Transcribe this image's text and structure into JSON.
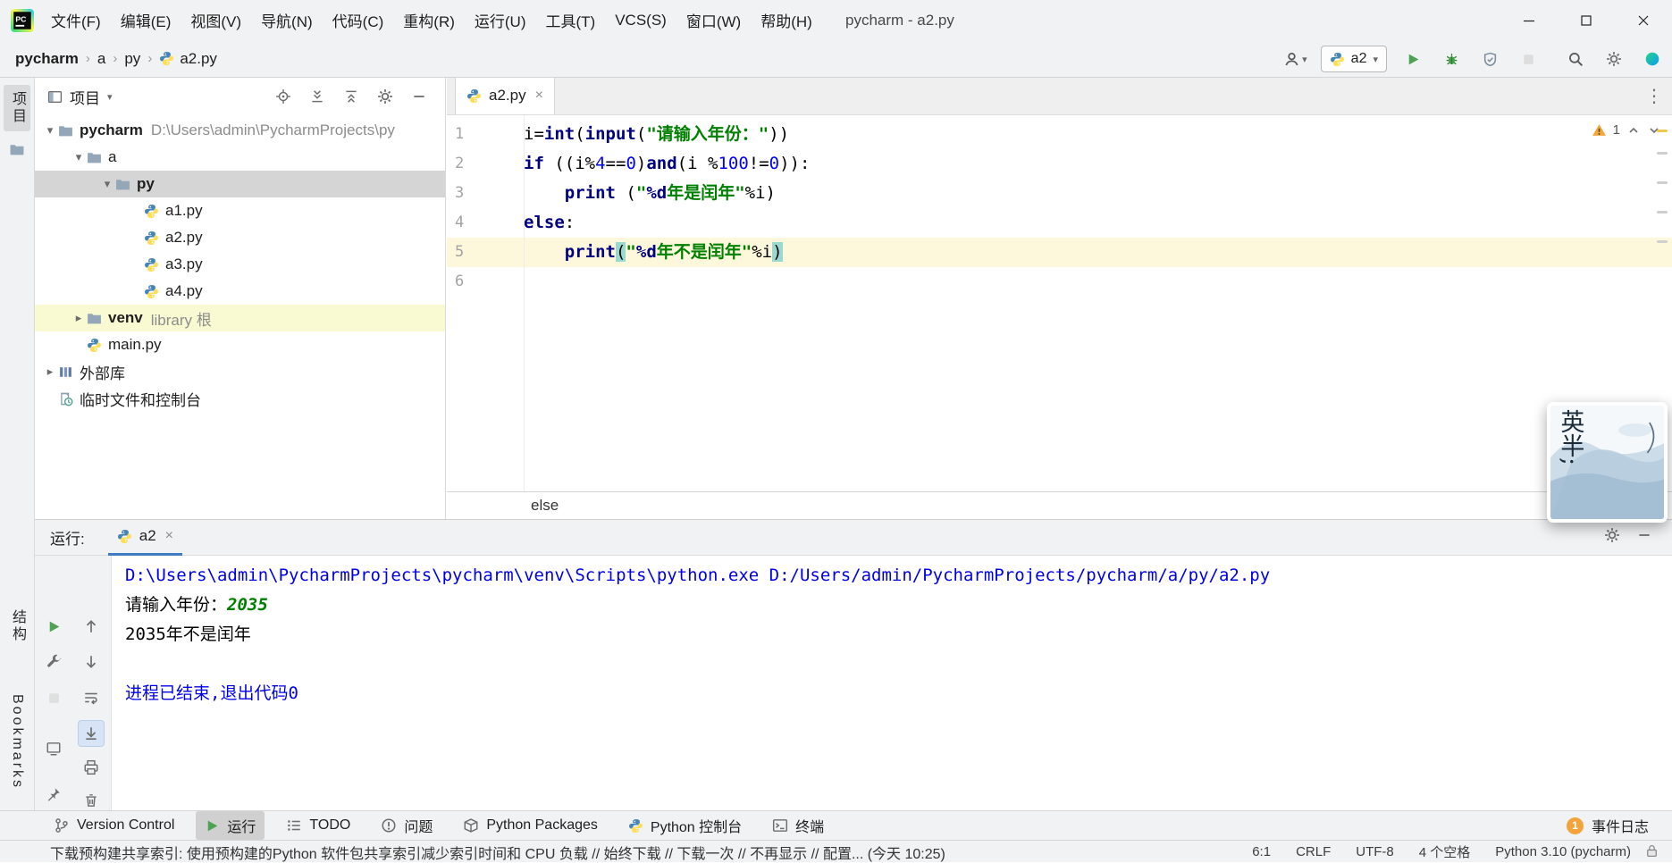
{
  "titlebar": {
    "menus": [
      "文件(F)",
      "编辑(E)",
      "视图(V)",
      "导航(N)",
      "代码(C)",
      "重构(R)",
      "运行(U)",
      "工具(T)",
      "VCS(S)",
      "窗口(W)",
      "帮助(H)"
    ],
    "title": "pycharm - a2.py"
  },
  "navbar": {
    "breadcrumbs": [
      {
        "label": "pycharm",
        "bold": true
      },
      {
        "label": "a"
      },
      {
        "label": "py"
      },
      {
        "label": "a2.py",
        "icon": "python-file"
      }
    ],
    "run_config": {
      "label": "a2"
    },
    "action_icons": [
      {
        "name": "run"
      },
      {
        "name": "debug"
      },
      {
        "name": "coverage"
      },
      {
        "name": "stop",
        "disabled": true
      }
    ],
    "tool_icons": [
      "search",
      "settings",
      "sphere"
    ]
  },
  "stripes": {
    "left_top": "项目",
    "left_middle": "结构",
    "left_bottom": "Bookmarks"
  },
  "project_panel": {
    "title": "项目",
    "header_icons": [
      "locate",
      "expand-all",
      "collapse-all",
      "settings",
      "hide"
    ],
    "tree": [
      {
        "label": "pycharm",
        "sublabel": "D:\\Users\\admin\\PycharmProjects\\py",
        "indent": 0,
        "chevron": "down",
        "icon": "folder",
        "bold": true
      },
      {
        "label": "a",
        "indent": 1,
        "chevron": "down",
        "icon": "folder"
      },
      {
        "label": "py",
        "indent": 2,
        "chevron": "down",
        "icon": "folder",
        "bold": true,
        "state": "selected"
      },
      {
        "label": "a1.py",
        "indent": 3,
        "icon": "python-file"
      },
      {
        "label": "a2.py",
        "indent": 3,
        "icon": "python-file"
      },
      {
        "label": "a3.py",
        "indent": 3,
        "icon": "python-file"
      },
      {
        "label": "a4.py",
        "indent": 3,
        "icon": "python-file"
      },
      {
        "label": "venv",
        "sublabel": "library 根",
        "indent": 1,
        "chevron": "right",
        "icon": "folder",
        "bold": true,
        "state": "library"
      },
      {
        "label": "main.py",
        "indent": 1,
        "icon": "python-file"
      },
      {
        "label": "外部库",
        "indent": 0,
        "chevron": "right",
        "icon": "libraries"
      },
      {
        "label": "临时文件和控制台",
        "indent": 0,
        "icon": "scratches"
      }
    ]
  },
  "editor": {
    "tab": {
      "label": "a2.py",
      "icon": "python-file"
    },
    "inspection": {
      "warnings": "1"
    },
    "breadcrumb": "else",
    "code": [
      {
        "num": "1",
        "tokens": [
          [
            "i=",
            "p"
          ],
          [
            "int",
            "kw"
          ],
          [
            "(",
            "p"
          ],
          [
            "input",
            "kw"
          ],
          [
            "(",
            "p"
          ],
          [
            "\"请输入年份：\"",
            "str"
          ],
          [
            "))",
            "p"
          ]
        ]
      },
      {
        "num": "2",
        "tokens": [
          [
            "if",
            "kw"
          ],
          [
            " ((i%",
            "p"
          ],
          [
            "4",
            "num"
          ],
          [
            "==",
            "p"
          ],
          [
            "0",
            "num"
          ],
          [
            ")",
            "p"
          ],
          [
            "and",
            "kw"
          ],
          [
            "(i %",
            "p"
          ],
          [
            "100",
            "num"
          ],
          [
            "!=",
            "p"
          ],
          [
            "0",
            "num"
          ],
          [
            ")):",
            "p"
          ]
        ]
      },
      {
        "num": "3",
        "tokens": [
          [
            "    ",
            "p"
          ],
          [
            "print",
            "kw"
          ],
          [
            " (",
            "p"
          ],
          [
            "\"",
            "str"
          ],
          [
            "%d",
            "fmt"
          ],
          [
            "年是闰年\"",
            "str"
          ],
          [
            "%i)",
            "p"
          ]
        ]
      },
      {
        "num": "4",
        "tokens": [
          [
            "else",
            "kw"
          ],
          [
            ":",
            "p"
          ]
        ]
      },
      {
        "num": "5",
        "current": true,
        "tokens": [
          [
            "    ",
            "p"
          ],
          [
            "print",
            "kw"
          ],
          [
            "(",
            "paren"
          ],
          [
            "\"",
            "str"
          ],
          [
            "%d",
            "fmt"
          ],
          [
            "年不是闰年\"",
            "str"
          ],
          [
            "%i",
            "p"
          ],
          [
            ")",
            "paren"
          ]
        ]
      },
      {
        "num": "6",
        "tokens": []
      }
    ]
  },
  "ime_popup": {
    "text": "英半;"
  },
  "run_panel": {
    "label": "运行:",
    "tab": {
      "label": "a2",
      "icon": "python-file"
    },
    "toolbar_col1": [
      {
        "name": "rerun"
      },
      {
        "name": "wrench"
      },
      {
        "name": "stop",
        "disabled": true
      },
      {
        "name": "console"
      },
      {
        "name": "pin"
      }
    ],
    "toolbar_col2": [
      {
        "name": "step-up"
      },
      {
        "name": "step-down"
      },
      {
        "name": "soft-wrap"
      },
      {
        "name": "scroll-end",
        "selected": true
      },
      {
        "name": "print"
      },
      {
        "name": "clear"
      }
    ],
    "header_icons": [
      "settings",
      "hide"
    ],
    "console": [
      {
        "segments": [
          [
            "D:\\Users\\admin\\PycharmProjects\\pycharm\\venv\\Scripts\\python.exe D:/Users/admin/PycharmProjects/pycharm/a/py/a2.py",
            "sys"
          ]
        ]
      },
      {
        "segments": [
          [
            "请输入年份：",
            "out"
          ],
          [
            "2035",
            "inp"
          ]
        ]
      },
      {
        "segments": [
          [
            "2035年不是闰年",
            "out"
          ]
        ]
      },
      {
        "segments": []
      },
      {
        "segments": [
          [
            "进程已结束,退出代码0",
            "sys"
          ]
        ]
      }
    ]
  },
  "bottom_bar": {
    "tabs": [
      {
        "label": "Version Control",
        "icon": "branch"
      },
      {
        "label": "运行",
        "icon": "run",
        "selected": true
      },
      {
        "label": "TODO",
        "icon": "todo"
      },
      {
        "label": "问题",
        "icon": "problems"
      },
      {
        "label": "Python Packages",
        "icon": "packages"
      },
      {
        "label": "Python 控制台",
        "icon": "python-file"
      },
      {
        "label": "终端",
        "icon": "terminal"
      }
    ],
    "event_log": {
      "badge": "1",
      "label": "事件日志"
    }
  },
  "statusbar": {
    "message": "下载预构建共享索引: 使用预构建的Python 软件包共享索引减少索引时间和 CPU 负载 // 始终下载 // 下载一次 // 不再显示 // 配置... (今天 10:25)",
    "items": [
      "6:1",
      "CRLF",
      "UTF-8",
      "4 个空格",
      "Python 3.10 (pycharm)"
    ]
  }
}
